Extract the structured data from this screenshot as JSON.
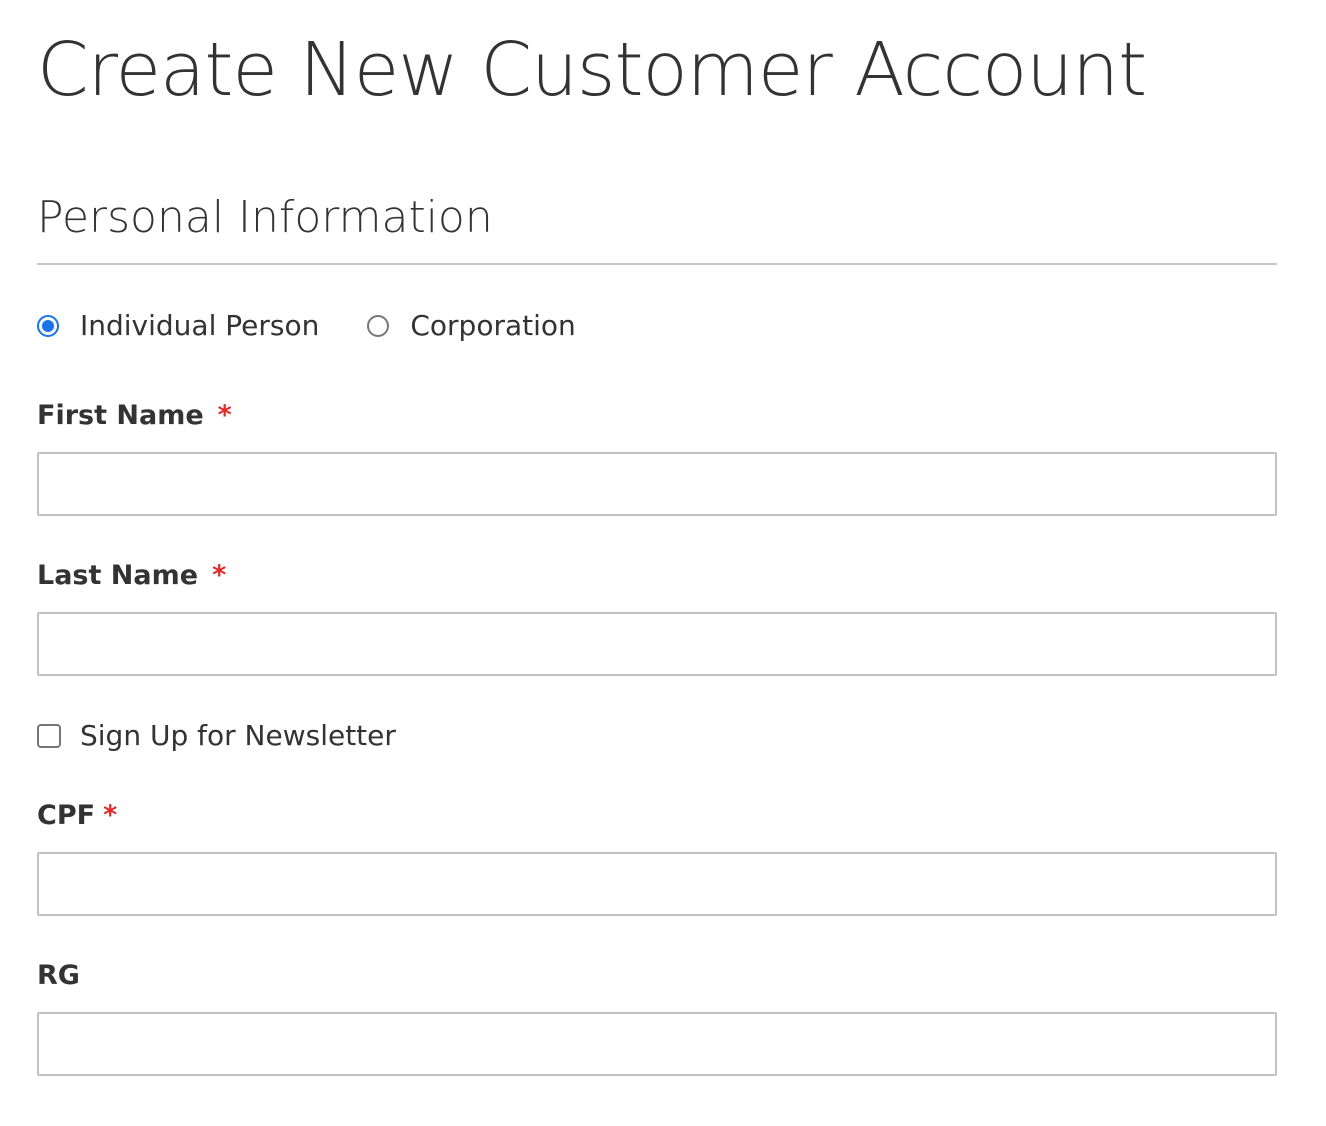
{
  "page": {
    "title": "Create New Customer Account"
  },
  "personal_information": {
    "section_title": "Personal Information",
    "customer_type": {
      "options": [
        {
          "label": "Individual Person",
          "selected": true
        },
        {
          "label": "Corporation",
          "selected": false
        }
      ]
    },
    "fields": {
      "first_name": {
        "label": "First Name",
        "required_mark": "*",
        "value": ""
      },
      "last_name": {
        "label": "Last Name",
        "required_mark": "*",
        "value": ""
      },
      "cpf": {
        "label": "CPF",
        "required_mark": "*",
        "value": ""
      },
      "rg": {
        "label": "RG",
        "value": ""
      }
    },
    "newsletter": {
      "label": "Sign Up for Newsletter",
      "checked": false
    }
  },
  "colors": {
    "text": "#333333",
    "required": "#e02b27",
    "radio_selected": "#1a73e8",
    "input_border": "#c2c2c2",
    "divider": "#c6c6c6"
  }
}
